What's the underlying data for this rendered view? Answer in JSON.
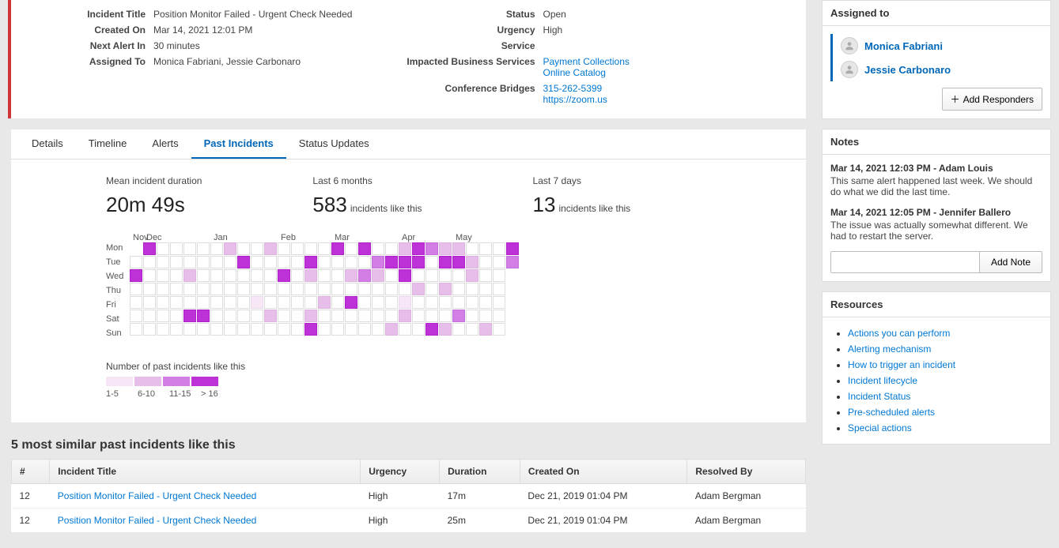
{
  "incident": {
    "labels": {
      "title": "Incident Title",
      "createdOn": "Created On",
      "nextAlert": "Next Alert In",
      "assignedTo": "Assigned To",
      "status": "Status",
      "urgency": "Urgency",
      "service": "Service",
      "impacted": "Impacted Business Services",
      "conference": "Conference Bridges"
    },
    "title": "Position Monitor Failed - Urgent Check Needed",
    "createdOn": "Mar 14, 2021 12:01 PM",
    "nextAlert": "30 minutes",
    "assignedTo": "Monica Fabriani, Jessie Carbonaro",
    "status": "Open",
    "urgency": "High",
    "service": "",
    "impacted": [
      "Payment Collections",
      "Online Catalog"
    ],
    "conference": [
      "315-262-5399",
      "https://zoom.us"
    ]
  },
  "tabs": {
    "items": [
      "Details",
      "Timeline",
      "Alerts",
      "Past Incidents",
      "Status Updates"
    ],
    "activeIndex": 3
  },
  "stats": {
    "meanLabel": "Mean incident duration",
    "meanValue": "20m 49s",
    "last6Label": "Last 6 months",
    "last6Value": "583",
    "last6Suffix": "incidents like this",
    "last7Label": "Last 7 days",
    "last7Value": "13",
    "last7Suffix": "incidents like this"
  },
  "heatmap": {
    "months": [
      "Nov",
      "Dec",
      "Jan",
      "Feb",
      "Mar",
      "Apr",
      "May"
    ],
    "monthWidths": [
      1,
      5,
      5,
      4,
      5,
      4,
      5
    ],
    "days": [
      "Mon",
      "Tue",
      "Wed",
      "Thu",
      "Fri",
      "Sat",
      "Sun"
    ],
    "legendTitle": "Number of past incidents like this",
    "legendLabels": [
      "1-5",
      "6-10",
      "11-15",
      "> 16"
    ],
    "rows": [
      [
        -1,
        4,
        0,
        0,
        0,
        0,
        0,
        2,
        0,
        0,
        2,
        0,
        0,
        0,
        0,
        4,
        0,
        4,
        0,
        0,
        2,
        4,
        3,
        2,
        2,
        0,
        0,
        0,
        4
      ],
      [
        0,
        0,
        0,
        0,
        0,
        0,
        0,
        0,
        4,
        0,
        0,
        0,
        0,
        4,
        0,
        0,
        0,
        0,
        3,
        4,
        4,
        4,
        0,
        4,
        4,
        2,
        0,
        0,
        3
      ],
      [
        4,
        0,
        0,
        0,
        2,
        0,
        0,
        0,
        0,
        0,
        0,
        4,
        0,
        2,
        0,
        0,
        2,
        3,
        2,
        0,
        4,
        0,
        0,
        0,
        0,
        2,
        0,
        0,
        -1
      ],
      [
        0,
        0,
        0,
        0,
        0,
        0,
        0,
        0,
        0,
        0,
        0,
        0,
        0,
        0,
        0,
        0,
        0,
        0,
        0,
        0,
        0,
        2,
        0,
        2,
        0,
        0,
        0,
        0,
        -1
      ],
      [
        0,
        0,
        0,
        0,
        0,
        0,
        0,
        0,
        0,
        1,
        0,
        0,
        0,
        0,
        2,
        0,
        4,
        0,
        0,
        0,
        1,
        0,
        0,
        0,
        0,
        0,
        0,
        0,
        -1
      ],
      [
        0,
        0,
        0,
        0,
        4,
        4,
        0,
        0,
        0,
        0,
        2,
        0,
        0,
        2,
        0,
        0,
        0,
        0,
        0,
        0,
        2,
        0,
        0,
        0,
        3,
        0,
        0,
        0,
        -1
      ],
      [
        0,
        0,
        0,
        0,
        0,
        0,
        0,
        0,
        0,
        0,
        0,
        0,
        0,
        4,
        0,
        0,
        0,
        0,
        0,
        2,
        0,
        0,
        4,
        2,
        0,
        0,
        2,
        0,
        -1
      ]
    ]
  },
  "similar": {
    "title": "5 most similar past incidents like this",
    "cols": [
      "#",
      "Incident Title",
      "Urgency",
      "Duration",
      "Created On",
      "Resolved By"
    ],
    "rows": [
      {
        "n": "12",
        "title": "Position Monitor Failed - Urgent Check Needed",
        "urgency": "High",
        "duration": "17m",
        "created": "Dec 21, 2019  01:04 PM",
        "resolved": "Adam Bergman"
      },
      {
        "n": "12",
        "title": "Position Monitor Failed - Urgent Check Needed",
        "urgency": "High",
        "duration": "25m",
        "created": "Dec 21, 2019  01:04 PM",
        "resolved": "Adam Bergman"
      }
    ]
  },
  "assigned": {
    "title": "Assigned to",
    "items": [
      "Monica Fabriani",
      "Jessie Carbonaro"
    ],
    "addButton": "Add Responders"
  },
  "notes": {
    "title": "Notes",
    "items": [
      {
        "meta": "Mar 14, 2021 12:03 PM - Adam Louis",
        "text": "This same alert happened last week. We should do what we did the last time."
      },
      {
        "meta": "Mar 14, 2021 12:05 PM - Jennifer Ballero",
        "text": "The issue was actually somewhat different. We had to restart the server."
      }
    ],
    "addButton": "Add Note"
  },
  "resources": {
    "title": "Resources",
    "items": [
      "Actions you can perform",
      "Alerting mechanism",
      "How to trigger an incident",
      "Incident lifecycle",
      "Incident Status",
      "Pre-scheduled alerts",
      "Special actions"
    ]
  }
}
